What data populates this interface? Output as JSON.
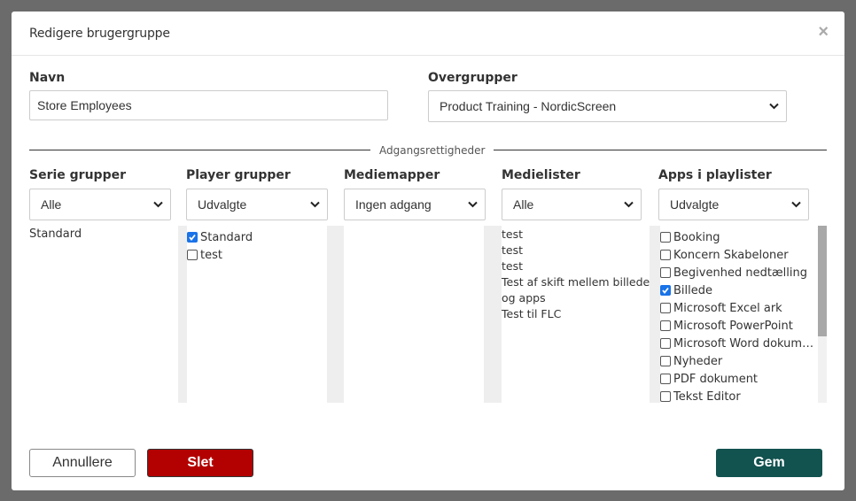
{
  "dialog": {
    "title": "Redigere brugergruppe"
  },
  "name_field": {
    "label": "Navn",
    "value": "Store Employees"
  },
  "parent_group": {
    "label": "Overgrupper",
    "selected": "Product Training - NordicScreen"
  },
  "section_divider": "Adgangsrettigheder",
  "columns": {
    "series_groups": {
      "label": "Serie grupper",
      "selected": "Alle",
      "items": [
        "Standard"
      ]
    },
    "player_groups": {
      "label": "Player grupper",
      "selected": "Udvalgte",
      "items": [
        {
          "label": "Standard",
          "checked": true
        },
        {
          "label": "test",
          "checked": false
        }
      ]
    },
    "media_folders": {
      "label": "Mediemapper",
      "selected": "Ingen adgang",
      "items": []
    },
    "media_lists": {
      "label": "Medielister",
      "selected": "Alle",
      "items": [
        "test",
        "test",
        "test",
        "Test af skift mellem billede",
        "og apps",
        "Test til FLC"
      ]
    },
    "apps": {
      "label": "Apps i playlister",
      "selected": "Udvalgte",
      "items": [
        {
          "label": "Booking",
          "checked": false
        },
        {
          "label": "Koncern Skabeloner",
          "checked": false
        },
        {
          "label": "Begivenhed nedtælling",
          "checked": false
        },
        {
          "label": "Billede",
          "checked": true
        },
        {
          "label": "Microsoft Excel ark",
          "checked": false
        },
        {
          "label": "Microsoft PowerPoint",
          "checked": false
        },
        {
          "label": "Microsoft Word dokum…",
          "checked": false
        },
        {
          "label": "Nyheder",
          "checked": false
        },
        {
          "label": "PDF dokument",
          "checked": false
        },
        {
          "label": "Tekst Editor",
          "checked": false
        }
      ]
    }
  },
  "buttons": {
    "cancel": "Annullere",
    "delete": "Slet",
    "save": "Gem"
  },
  "colors": {
    "delete": "#b30000",
    "save": "#12524f",
    "checkbox_checked": "#1a73e8"
  }
}
